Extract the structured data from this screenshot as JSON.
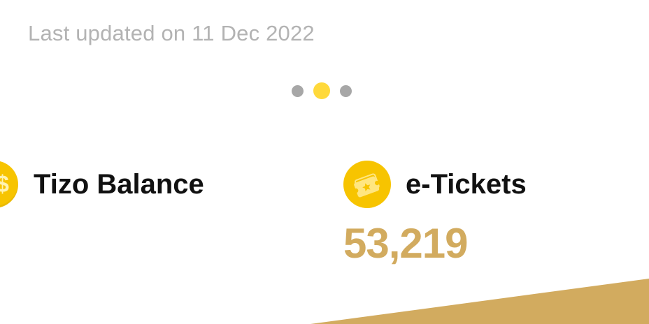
{
  "header": {
    "last_updated": "Last updated on 11 Dec 2022"
  },
  "carousel": {
    "dots": [
      "inactive",
      "active",
      "inactive"
    ],
    "active_color": "#ffd93b",
    "inactive_color": "#a7a7a7"
  },
  "balance_card": {
    "title": "Tizo Balance",
    "icon": "coin-icon"
  },
  "tickets_card": {
    "title": "e-Tickets",
    "icon": "ticket-icon",
    "value": "53,219"
  },
  "colors": {
    "accent_gold": "#d2ab5f",
    "icon_yellow": "#f7c400"
  }
}
